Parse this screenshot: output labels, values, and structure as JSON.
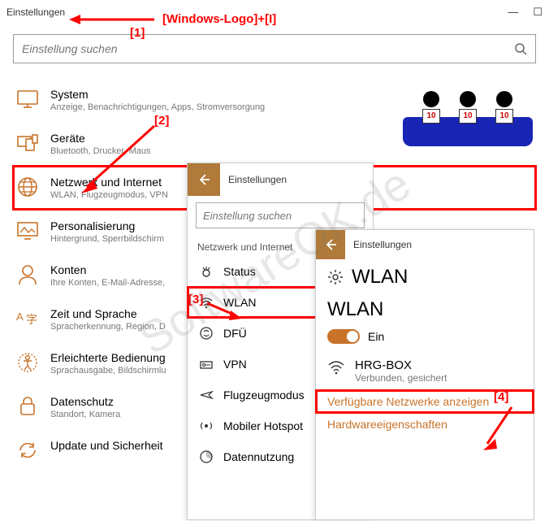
{
  "main": {
    "title": "Einstellungen",
    "search_placeholder": "Einstellung suchen",
    "categories": [
      {
        "title": "System",
        "sub": "Anzeige, Benachrichtigungen, Apps, Stromversorgung",
        "icon": "display-icon"
      },
      {
        "title": "Geräte",
        "sub": "Bluetooth, Drucker, Maus",
        "icon": "devices-icon"
      },
      {
        "title": "Netzwerk und Internet",
        "sub": "WLAN, Flugzeugmodus, VPN",
        "icon": "globe-icon"
      },
      {
        "title": "Personalisierung",
        "sub": "Hintergrund, Sperrbildschirm",
        "icon": "personalize-icon"
      },
      {
        "title": "Konten",
        "sub": "Ihre Konten, E-Mail-Adresse,",
        "icon": "account-icon"
      },
      {
        "title": "Zeit und Sprache",
        "sub": "Spracherkennung, Region, D",
        "icon": "time-lang-icon"
      },
      {
        "title": "Erleichterte Bedienung",
        "sub": "Sprachausgabe, Bildschirmlu",
        "icon": "ease-icon"
      },
      {
        "title": "Datenschutz",
        "sub": "Standort, Kamera",
        "icon": "privacy-icon"
      },
      {
        "title": "Update und Sicherheit",
        "sub": "",
        "icon": "update-icon"
      }
    ]
  },
  "sub1": {
    "title": "Einstellungen",
    "search_placeholder": "Einstellung suchen",
    "section": "Netzwerk und Internet",
    "items": [
      {
        "label": "Status",
        "icon": "status-icon"
      },
      {
        "label": "WLAN",
        "icon": "wifi-icon"
      },
      {
        "label": "DFÜ",
        "icon": "dialup-icon"
      },
      {
        "label": "VPN",
        "icon": "vpn-icon"
      },
      {
        "label": "Flugzeugmodus",
        "icon": "airplane-icon"
      },
      {
        "label": "Mobiler Hotspot",
        "icon": "hotspot-icon"
      },
      {
        "label": "Datennutzung",
        "icon": "data-icon"
      }
    ]
  },
  "sub2": {
    "title": "Einstellungen",
    "page_title": "WLAN",
    "section_title": "WLAN",
    "toggle_label": "Ein",
    "network": {
      "name": "HRG-BOX",
      "status": "Verbunden, gesichert"
    },
    "links": [
      "Verfügbare Netzwerke anzeigen",
      "Hardwareeigenschaften"
    ]
  },
  "annotations": {
    "shortcut": "[Windows-Logo]+[I]",
    "n1": "[1]",
    "n2": "[2]",
    "n3": "[3]",
    "n4": "[4]"
  },
  "watermark": "SoftwareOK.de",
  "judges_score": "10"
}
